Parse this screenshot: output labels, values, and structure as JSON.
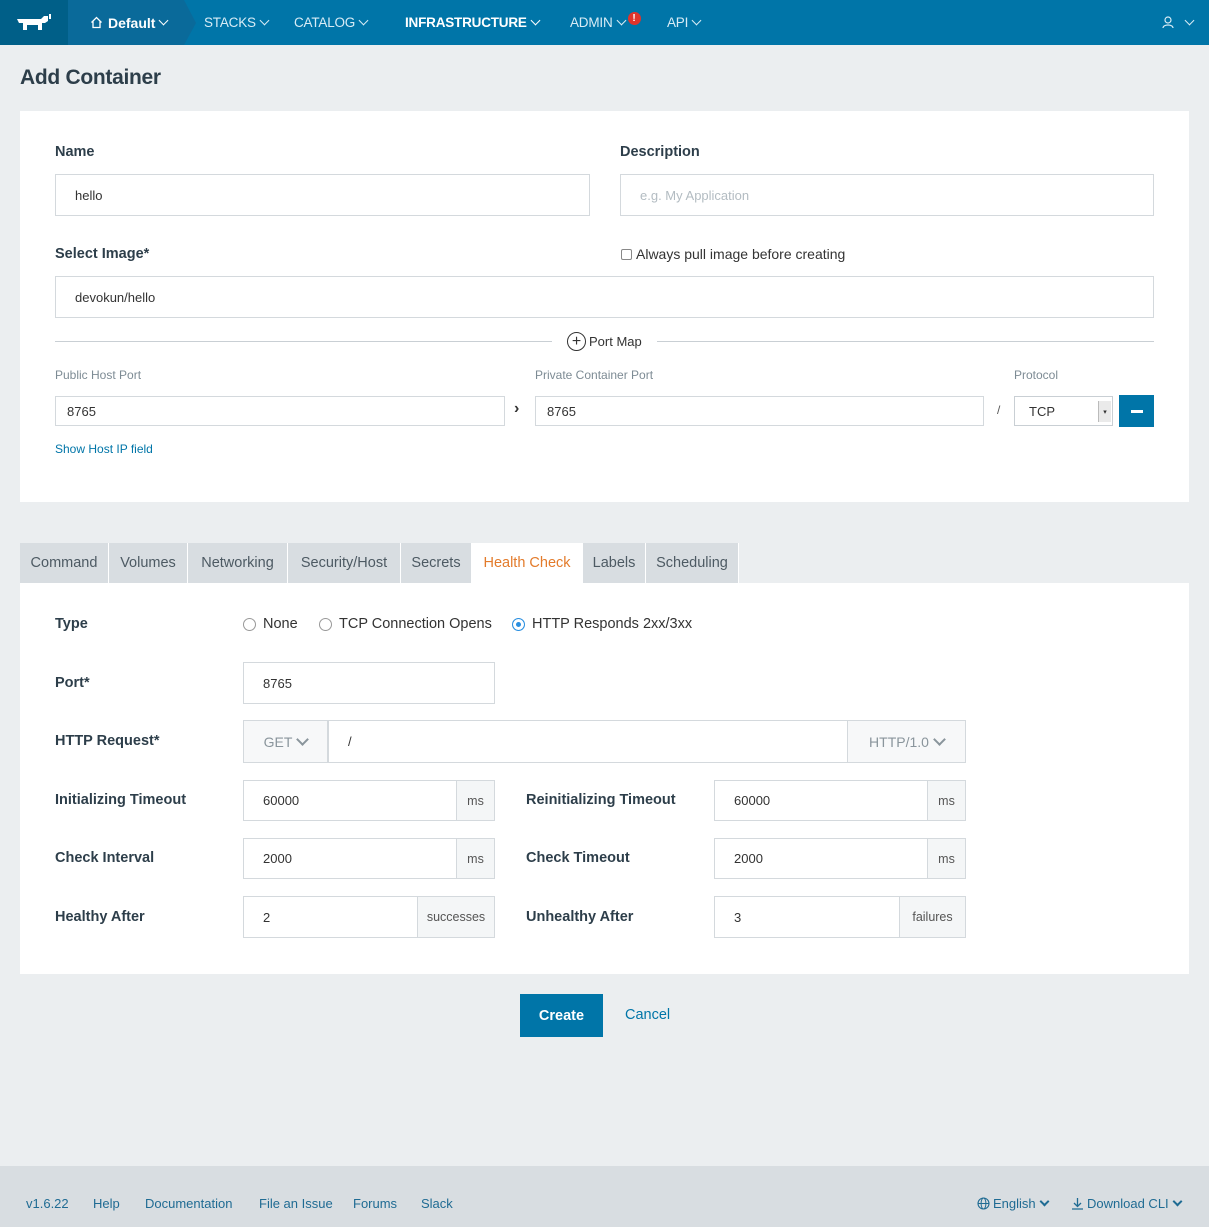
{
  "nav": {
    "environment": "Default",
    "items": [
      "STACKS",
      "CATALOG",
      "INFRASTRUCTURE",
      "ADMIN",
      "API"
    ],
    "active_item": "INFRASTRUCTURE",
    "admin_alert": "!",
    "colors": {
      "bar": "#0075a8",
      "env": "#0a6a9a",
      "logo_bg": "#005f88"
    }
  },
  "page_title": "Add Container",
  "form": {
    "name_label": "Name",
    "name_value": "hello",
    "description_label": "Description",
    "description_placeholder": "e.g. My Application",
    "image_label": "Select Image*",
    "image_value": "devokun/hello",
    "always_pull_label": "Always pull image before creating",
    "always_pull_checked": false,
    "port_map_label": "Port Map",
    "public_port_label": "Public Host Port",
    "public_port_value": "8765",
    "private_port_label": "Private Container Port",
    "private_port_value": "8765",
    "protocol_label": "Protocol",
    "protocol_value": "TCP",
    "separator": "/",
    "show_host_ip": "Show Host IP field"
  },
  "tabs": [
    "Command",
    "Volumes",
    "Networking",
    "Security/Host",
    "Secrets",
    "Health Check",
    "Labels",
    "Scheduling"
  ],
  "active_tab": "Health Check",
  "health": {
    "type_label": "Type",
    "type_options": [
      "None",
      "TCP Connection Opens",
      "HTTP Responds 2xx/3xx"
    ],
    "type_selected": "HTTP Responds 2xx/3xx",
    "port_label": "Port*",
    "port_value": "8765",
    "http_request_label": "HTTP Request*",
    "http_method": "GET",
    "http_path": "/",
    "http_version": "HTTP/1.0",
    "init_timeout_label": "Initializing Timeout",
    "init_timeout_value": "60000",
    "reinit_timeout_label": "Reinitializing Timeout",
    "reinit_timeout_value": "60000",
    "check_interval_label": "Check Interval",
    "check_interval_value": "2000",
    "check_timeout_label": "Check Timeout",
    "check_timeout_value": "2000",
    "healthy_after_label": "Healthy After",
    "healthy_after_value": "2",
    "unhealthy_after_label": "Unhealthy After",
    "unhealthy_after_value": "3",
    "unit_ms": "ms",
    "unit_successes": "successes",
    "unit_failures": "failures"
  },
  "actions": {
    "create": "Create",
    "cancel": "Cancel"
  },
  "footer": {
    "version": "v1.6.22",
    "links": [
      "Help",
      "Documentation",
      "File an Issue",
      "Forums",
      "Slack"
    ],
    "language": "English",
    "download": "Download CLI"
  }
}
